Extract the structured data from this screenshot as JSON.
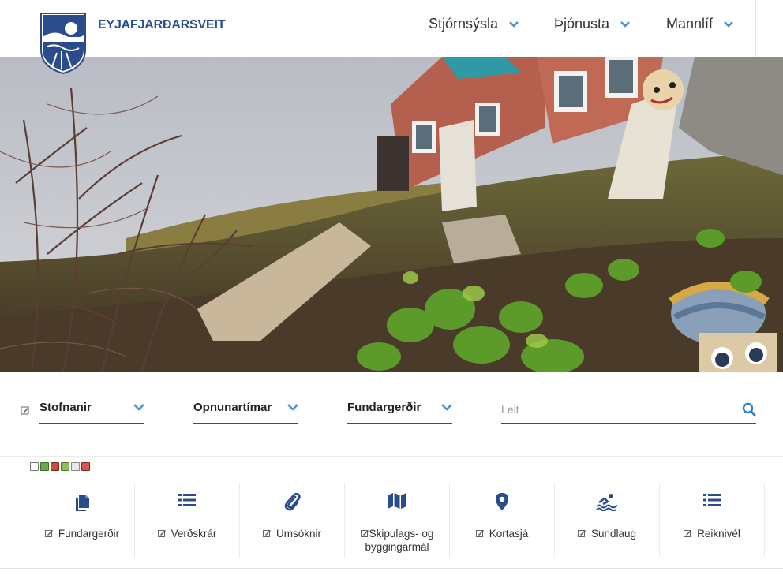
{
  "header": {
    "site_name": "EYJAFJARÐARSVEIT",
    "nav": [
      {
        "label": "Stjórnsýsla"
      },
      {
        "label": "Þjónusta"
      },
      {
        "label": "Mannlíf"
      }
    ]
  },
  "quickbar": {
    "dropdowns": [
      {
        "label": "Stofnanir"
      },
      {
        "label": "Opnunartímar"
      },
      {
        "label": "Fundargerðir"
      }
    ],
    "search": {
      "placeholder": "Leit"
    }
  },
  "links": [
    {
      "icon": "documents-icon",
      "label": "Fundargerðir"
    },
    {
      "icon": "list-icon",
      "label": "Verðskrár"
    },
    {
      "icon": "paperclip-icon",
      "label": "Umsóknir"
    },
    {
      "icon": "map-icon",
      "label": "Skipulags- og byggingarmál"
    },
    {
      "icon": "location-pin-icon",
      "label": "Kortasjá"
    },
    {
      "icon": "swimming-icon",
      "label": "Sundlaug"
    },
    {
      "icon": "list-icon",
      "label": "Reiknivél"
    }
  ],
  "colors": {
    "brand": "#2a4b8c",
    "accent": "#4a90d9"
  }
}
